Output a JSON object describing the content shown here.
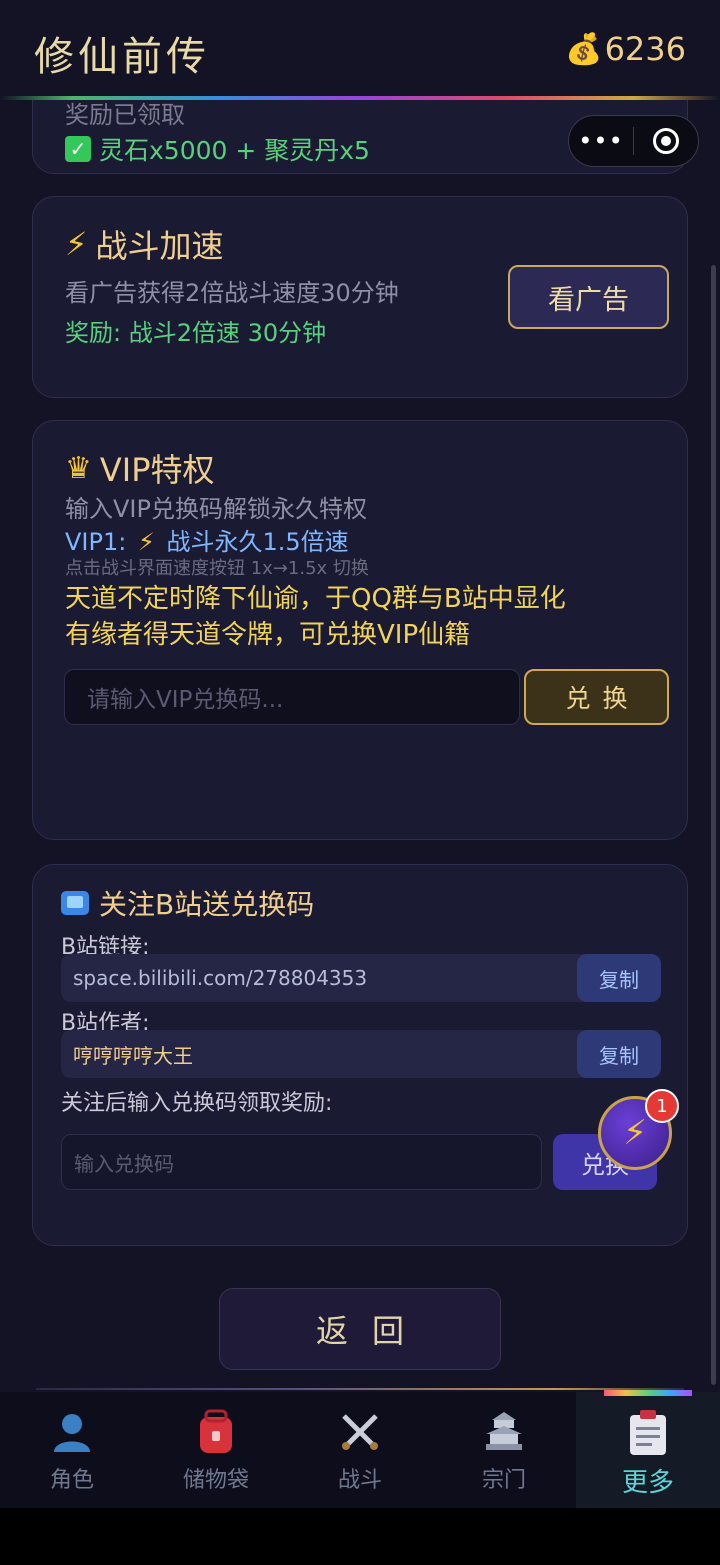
{
  "header": {
    "title": "修仙前传",
    "coin_icon": "money-bag-icon",
    "coins": "6236"
  },
  "capsule": {
    "more": "•••"
  },
  "reward_card": {
    "claimed": "奖励已领取",
    "items": "灵石x5000 + 聚灵丹x5"
  },
  "speed_card": {
    "title": "战斗加速",
    "desc": "看广告获得2倍战斗速度30分钟",
    "reward": "奖励: 战斗2倍速 30分钟",
    "button": "看广告"
  },
  "vip_card": {
    "title": "VIP特权",
    "desc": "输入VIP兑换码解锁永久特权",
    "perk_prefix": "VIP1:",
    "perk_text": "战斗永久1.5倍速",
    "hint": "点击战斗界面速度按钮 1x→1.5x 切换",
    "notice_line1": "天道不定时降下仙谕，于QQ群与B站中显化",
    "notice_line2": "有缘者得天道令牌，可兑换VIP仙籍",
    "input_placeholder": "请输入VIP兑换码...",
    "button": "兑换"
  },
  "bili_card": {
    "title": "关注B站送兑换码",
    "link_label": "B站链接:",
    "link_value": "space.bilibili.com/278804353",
    "author_label": "B站作者:",
    "author_value": "哼哼哼哼大王",
    "copy_label": "复制",
    "redeem_label": "关注后输入兑换码领取奖励:",
    "input_placeholder": "输入兑换码",
    "button": "兑换"
  },
  "fab": {
    "badge": "1"
  },
  "back_button": "返回",
  "nav": [
    {
      "label": "角色",
      "icon": "character-icon"
    },
    {
      "label": "储物袋",
      "icon": "backpack-icon"
    },
    {
      "label": "战斗",
      "icon": "crossed-swords-icon"
    },
    {
      "label": "宗门",
      "icon": "pagoda-icon"
    },
    {
      "label": "更多",
      "icon": "clipboard-icon",
      "active": true
    }
  ],
  "colors": {
    "bg": "#131325",
    "card": "#1a1a33",
    "gold": "#f0cf8e",
    "green": "#58d17c",
    "accent_blue": "#7fb6ff",
    "active_nav": "#5fd3d6"
  }
}
